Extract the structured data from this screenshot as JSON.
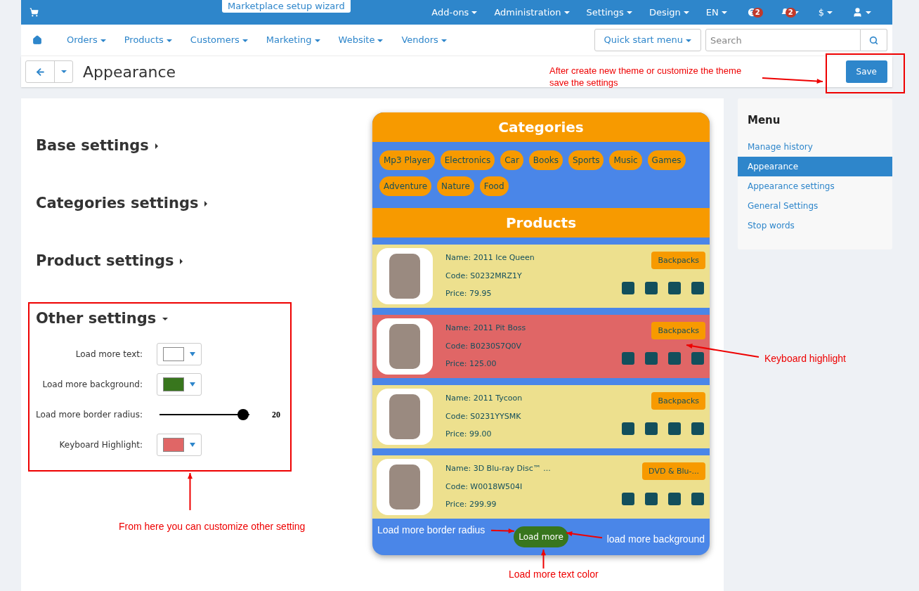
{
  "topbar": {
    "wizard": "Marketplace setup wizard",
    "menus": [
      {
        "label": "Add-ons",
        "kind": "text"
      },
      {
        "label": "Administration",
        "kind": "text"
      },
      {
        "label": "Settings",
        "kind": "text"
      },
      {
        "label": "Design",
        "kind": "text"
      },
      {
        "label": "EN",
        "kind": "text"
      },
      {
        "kind": "help",
        "badge": "2"
      },
      {
        "kind": "bell",
        "badge": "2"
      },
      {
        "label": "$",
        "kind": "text"
      },
      {
        "kind": "user"
      }
    ]
  },
  "nav": {
    "items": [
      "Orders",
      "Products",
      "Customers",
      "Marketing",
      "Website",
      "Vendors"
    ],
    "quick_start": "Quick start menu",
    "search": {
      "placeholder": "Search"
    }
  },
  "header": {
    "title": "Appearance",
    "save": "Save"
  },
  "sections": [
    {
      "title": "Base settings",
      "expanded": false
    },
    {
      "title": "Categories settings",
      "expanded": false
    },
    {
      "title": "Product settings",
      "expanded": false
    },
    {
      "title": "Other settings",
      "expanded": true,
      "fields": [
        {
          "kind": "color",
          "label": "Load more text:",
          "color": "#ffffff"
        },
        {
          "kind": "color",
          "label": "Load more background:",
          "color": "#38761d"
        },
        {
          "kind": "slider",
          "label": "Load more border radius:",
          "level": 0.93,
          "reading": "20"
        },
        {
          "kind": "color",
          "label": "Keyboard Highlight:",
          "color": "#e06666"
        }
      ]
    }
  ],
  "preview": {
    "categories_title": "Categories",
    "categories": [
      "Mp3 Player",
      "Electronics",
      "Car",
      "Books",
      "Sports",
      "Music",
      "Games",
      "Adventure",
      "Nature",
      "Food"
    ],
    "products_title": "Products",
    "products": [
      {
        "name": "Name: 2011 Ice Queen",
        "code": "Code: S0232MRZ1Y",
        "price": "Price: 79.95",
        "category": "Backpacks",
        "highlighted": false
      },
      {
        "name": "Name: 2011 Pit Boss",
        "code": "Code: B0230S7Q0V",
        "price": "Price: 125.00",
        "category": "Backpacks",
        "highlighted": true
      },
      {
        "name": "Name: 2011 Tycoon",
        "code": "Code: S0231YYSMK",
        "price": "Price: 99.00",
        "category": "Backpacks",
        "highlighted": false
      },
      {
        "name": "Name: 3D Blu-ray Disc™ ...",
        "code": "Code: W0018W504I",
        "price": "Price: 299.99",
        "category": "DVD & Blu-...",
        "highlighted": false
      }
    ],
    "load_more": "Load more",
    "note_left": "Load more border radius",
    "note_right": "load more background"
  },
  "menu": {
    "title": "Menu",
    "items": [
      {
        "label": "Manage history",
        "selected": false
      },
      {
        "label": "Appearance",
        "selected": true
      },
      {
        "label": "Appearance settings",
        "selected": false
      },
      {
        "label": "General Settings",
        "selected": false
      },
      {
        "label": "Stop words",
        "selected": false
      }
    ]
  },
  "annotations": [
    "After create new theme or customize the theme\nsave the settings",
    "Keyboard highlight",
    "From here you can customize other setting",
    "Load more text color"
  ]
}
